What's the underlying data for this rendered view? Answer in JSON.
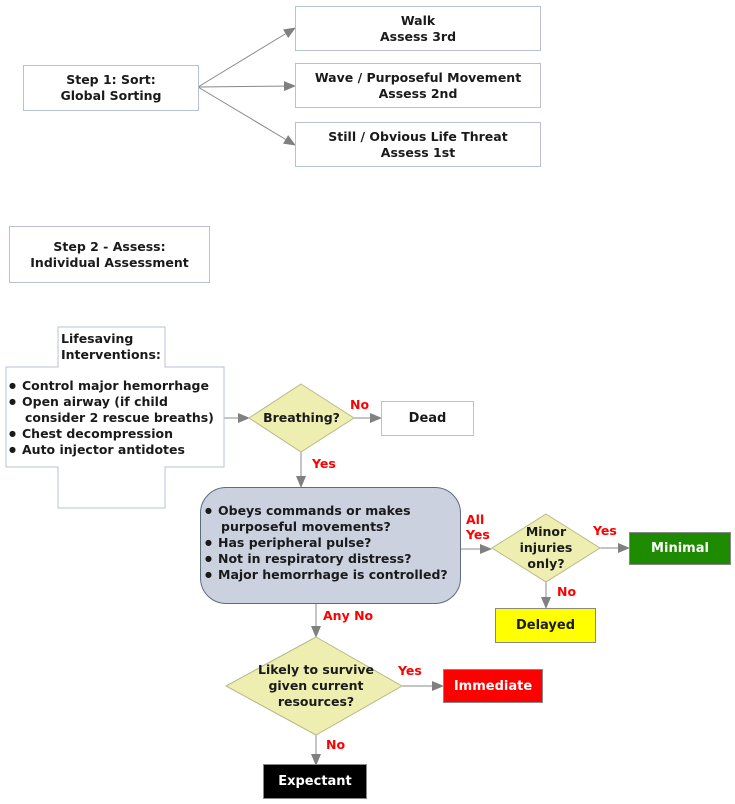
{
  "step1": {
    "line1": "Step 1: Sort:",
    "line2": "Global Sorting",
    "targets": [
      {
        "line1": "Walk",
        "line2": "Assess 3rd"
      },
      {
        "line1": "Wave / Purposeful Movement",
        "line2": "Assess 2nd"
      },
      {
        "line1": "Still / Obvious Life Threat",
        "line2": "Assess 1st"
      }
    ]
  },
  "step2": {
    "line1": "Step 2 - Assess:",
    "line2": "Individual Assessment"
  },
  "lifesaving": {
    "title1": "Lifesaving",
    "title2": "Interventions:",
    "items": [
      "Control major hemorrhage",
      "Open airway (if child\n consider 2 rescue breaths)",
      "Chest decompression",
      "Auto injector antidotes"
    ],
    "item_open_airway_l1": "Open airway (if child",
    "item_open_airway_l2": "consider 2 rescue breaths)"
  },
  "breathing": {
    "question": "Breathing?",
    "no_label": "No",
    "yes_label": "Yes",
    "dead": "Dead"
  },
  "assessment": {
    "items": [
      "Obeys commands or makes",
      "purposeful movements?",
      "Has peripheral pulse?",
      "Not in respiratory distress?",
      "Major hemorrhage is controlled?"
    ],
    "all_yes_l1": "All",
    "all_yes_l2": "Yes",
    "any_no": "Any No"
  },
  "minor": {
    "q1": "Minor",
    "q2": "injuries",
    "q3": "only?",
    "yes_label": "Yes",
    "no_label": "No"
  },
  "survive": {
    "q1": "Likely to survive",
    "q2": "given current",
    "q3": "resources?",
    "yes_label": "Yes",
    "no_label": "No"
  },
  "categories": {
    "minimal": {
      "label": "Minimal",
      "color": "#1e8a00"
    },
    "delayed": {
      "label": "Delayed",
      "color": "#ffff00"
    },
    "immediate": {
      "label": "Immediate",
      "color": "#ff0000"
    },
    "expectant": {
      "label": "Expectant",
      "color": "#000000"
    }
  },
  "colors": {
    "decision_fill": "#eeeeb0",
    "assessment_fill": "#cbd1de",
    "edge_label": "#ff0000",
    "arrow": "#808080"
  }
}
